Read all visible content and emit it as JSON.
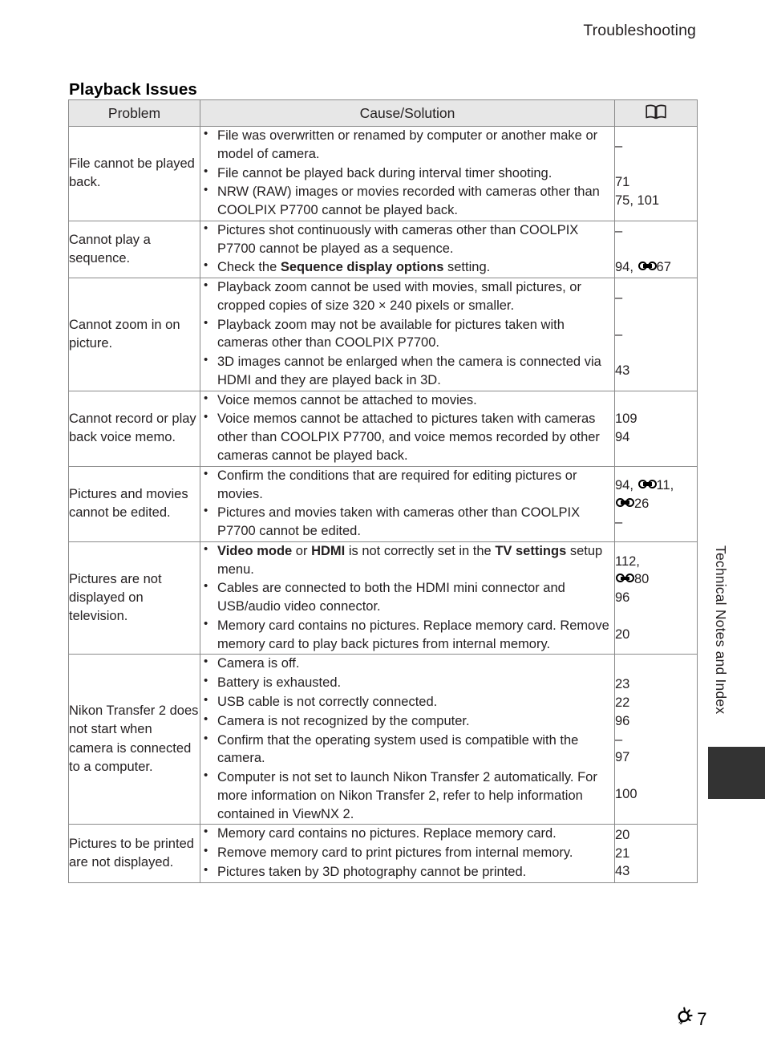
{
  "running_head": "Troubleshooting",
  "section_title": "Playback Issues",
  "table": {
    "headers": {
      "problem": "Problem",
      "cause": "Cause/Solution",
      "reference_icon": "open-book-icon"
    },
    "rows": [
      {
        "problem": "File cannot be played back.",
        "causes": [
          "File was overwritten or renamed by computer or another make or model of camera.",
          "File cannot be played back during interval timer shooting.",
          "NRW (RAW) images or movies recorded with cameras other than COOLPIX P7700 cannot be played back."
        ],
        "refs": [
          "–",
          "",
          "71",
          "75, 101"
        ]
      },
      {
        "problem": "Cannot play a sequence.",
        "causes": [
          "Pictures shot continuously with cameras other than COOLPIX P7700 cannot be played as a sequence.",
          "Check the Sequence display options setting."
        ],
        "causes_bold": [
          null,
          "Sequence display options"
        ],
        "refs": [
          "–",
          "",
          "94, °67"
        ]
      },
      {
        "problem": "Cannot zoom in on picture.",
        "causes": [
          "Playback zoom cannot be used with movies, small pictures, or cropped copies of size 320 × 240 pixels or smaller.",
          "Playback zoom may not be available for pictures taken with cameras other than COOLPIX P7700.",
          "3D images cannot be enlarged when the camera is connected via HDMI and they are played back in 3D."
        ],
        "refs": [
          "–",
          "",
          "–",
          "",
          "43"
        ]
      },
      {
        "problem": "Cannot record or play back voice memo.",
        "causes": [
          "Voice memos cannot be attached to movies.",
          "Voice memos cannot be attached to pictures taken with cameras other than COOLPIX P7700, and voice memos recorded by other cameras cannot be played back."
        ],
        "refs": [
          "109",
          "94"
        ]
      },
      {
        "problem": "Pictures and movies cannot be edited.",
        "causes": [
          "Confirm the conditions that are required for editing pictures or movies.",
          "Pictures and movies taken with cameras other than COOLPIX P7700 cannot be edited."
        ],
        "refs": [
          "94, °11,",
          "°26",
          "–"
        ]
      },
      {
        "problem": "Pictures are not displayed on television.",
        "causes": [
          "Video mode or HDMI is not correctly set in the TV settings setup menu.",
          "Cables are connected to both the HDMI mini connector and USB/audio video connector.",
          "Memory card contains no pictures. Replace memory card. Remove memory card to play back pictures from internal memory."
        ],
        "refs": [
          "112,",
          "°80",
          "96",
          "",
          "20"
        ]
      },
      {
        "problem": "Nikon Transfer 2 does not start when camera is connected to a computer.",
        "causes": [
          "Camera is off.",
          "Battery is exhausted.",
          "USB cable is not correctly connected.",
          "Camera is not recognized by the computer.",
          "Confirm that the operating system used is compatible with the camera.",
          "Computer is not set to launch Nikon Transfer 2 automatically. For more information on Nikon Transfer 2, refer to help information contained in ViewNX 2."
        ],
        "refs": [
          "23",
          "22",
          "96",
          "–",
          "97",
          "",
          "100"
        ]
      },
      {
        "problem": "Pictures to be printed are not displayed.",
        "causes": [
          "Memory card contains no pictures. Replace memory card.",
          "Remove memory card to print pictures from internal memory.",
          "Pictures taken by 3D photography cannot be printed."
        ],
        "refs": [
          "20",
          "21",
          "43"
        ]
      }
    ]
  },
  "thumb_index": {
    "label": "Technical Notes and Index"
  },
  "footer": {
    "icon": "lightbulb-icon",
    "page_number": "7"
  },
  "colors": {
    "text": "#231f20",
    "header_fill": "#e7e7e7",
    "rule": "#8a8a8a",
    "thumb_tab": "#333333"
  }
}
